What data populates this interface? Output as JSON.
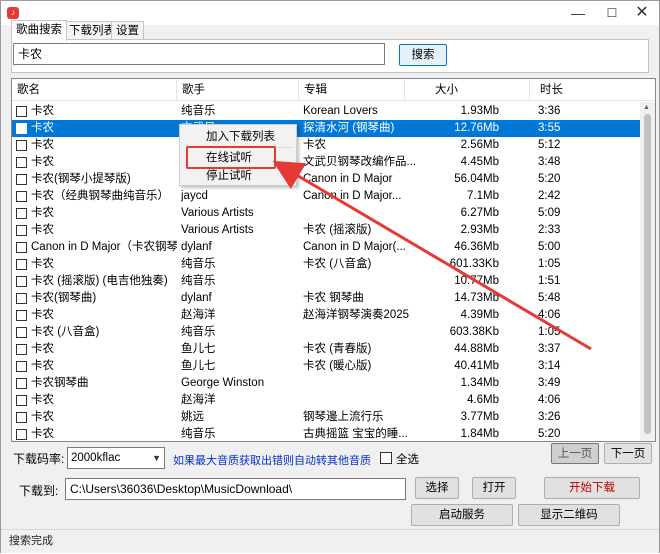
{
  "window": {
    "app_icon": "app-icon",
    "minimize": "—",
    "maximize": "☐",
    "close": "✕"
  },
  "tabs": [
    {
      "label": "歌曲搜索"
    },
    {
      "label": "下载列表"
    },
    {
      "label": "设置"
    }
  ],
  "search": {
    "value": "卡农",
    "button_label": "搜索"
  },
  "table": {
    "columns": [
      "歌名",
      "歌手",
      "专辑",
      "大小",
      "时长"
    ],
    "rows": [
      {
        "name": "卡农",
        "singer": "纯音乐",
        "album": "Korean Lovers",
        "size": "1.93Mb",
        "duration": "3:36"
      },
      {
        "name": "卡农",
        "singer": "文武贝",
        "album": "探清水河 (钢琴曲)",
        "size": "12.76Mb",
        "duration": "3:55"
      },
      {
        "name": "卡农",
        "singer": "",
        "album": "卡农",
        "size": "2.56Mb",
        "duration": "5:12"
      },
      {
        "name": "卡农",
        "singer": "",
        "album": "文武贝钢琴改编作品...",
        "size": "4.45Mb",
        "duration": "3:48"
      },
      {
        "name": "卡农(钢琴小提琴版)",
        "singer": "",
        "album": "Canon in D Major",
        "size": "56.04Mb",
        "duration": "5:20"
      },
      {
        "name": "卡农（经典钢琴曲纯音乐）",
        "singer": "jaycd",
        "album": "Canon in D Major...",
        "size": "7.1Mb",
        "duration": "2:42"
      },
      {
        "name": "卡农",
        "singer": "Various Artists",
        "album": "",
        "size": "6.27Mb",
        "duration": "5:09"
      },
      {
        "name": "卡农",
        "singer": "Various Artists",
        "album": "卡农 (摇滚版)",
        "size": "2.93Mb",
        "duration": "2:33"
      },
      {
        "name": "Canon in D Major（卡农钢琴...",
        "singer": "dylanf",
        "album": "Canon in D Major(...",
        "size": "46.36Mb",
        "duration": "5:00"
      },
      {
        "name": "卡农",
        "singer": "纯音乐",
        "album": "卡农 (八音盒)",
        "size": "601.33Kb",
        "duration": "1:05"
      },
      {
        "name": "卡农 (摇滚版) (电吉他独奏)",
        "singer": "纯音乐",
        "album": "",
        "size": "10.77Mb",
        "duration": "1:51"
      },
      {
        "name": "卡农(钢琴曲)",
        "singer": "dylanf",
        "album": "卡农 钢琴曲",
        "size": "14.73Mb",
        "duration": "5:48"
      },
      {
        "name": "卡农",
        "singer": "赵海洋",
        "album": "赵海洋钢琴演奏2025",
        "size": "4.39Mb",
        "duration": "4:06"
      },
      {
        "name": "卡农 (八音盒)",
        "singer": "纯音乐",
        "album": "",
        "size": "603.38Kb",
        "duration": "1:05"
      },
      {
        "name": "卡农",
        "singer": "鱼儿七",
        "album": "卡农 (青春版)",
        "size": "44.88Mb",
        "duration": "3:37"
      },
      {
        "name": "卡农",
        "singer": "鱼儿七",
        "album": "卡农 (暖心版)",
        "size": "40.41Mb",
        "duration": "3:14"
      },
      {
        "name": "卡农钢琴曲",
        "singer": "George Winston",
        "album": "",
        "size": "1.34Mb",
        "duration": "3:49"
      },
      {
        "name": "卡农",
        "singer": "赵海洋",
        "album": "",
        "size": "4.6Mb",
        "duration": "4:06"
      },
      {
        "name": "卡农",
        "singer": "姚远",
        "album": "钢琴邊上流行乐",
        "size": "3.77Mb",
        "duration": "3:26"
      },
      {
        "name": "卡农",
        "singer": "纯音乐",
        "album": "古典摇篮 宝宝的睡...",
        "size": "1.84Mb",
        "duration": "5:20"
      }
    ],
    "selected_row": 1
  },
  "context_menu": {
    "items": [
      "加入下载列表",
      "在线试听",
      "停止试听"
    ],
    "highlighted": "在线试听"
  },
  "bottom": {
    "bitrate_label": "下载码率:",
    "bitrate_value": "2000kflac",
    "hint": "如果最大音质获取出错则自动转其他音质",
    "select_all_label": "全选",
    "prev_label": "上一页",
    "next_label": "下一页",
    "download_to_label": "下载到:",
    "download_path": "C:\\Users\\36036\\Desktop\\MusicDownload\\",
    "choose_label": "选择",
    "open_label": "打开",
    "start_label": "开始下载",
    "service_label": "启动服务",
    "qrcode_label": "显示二维码"
  },
  "status": {
    "text": "搜索完成"
  },
  "colors": {
    "selection": "#0078d7",
    "annotation": "#e53935",
    "hint": "#0033cc"
  }
}
